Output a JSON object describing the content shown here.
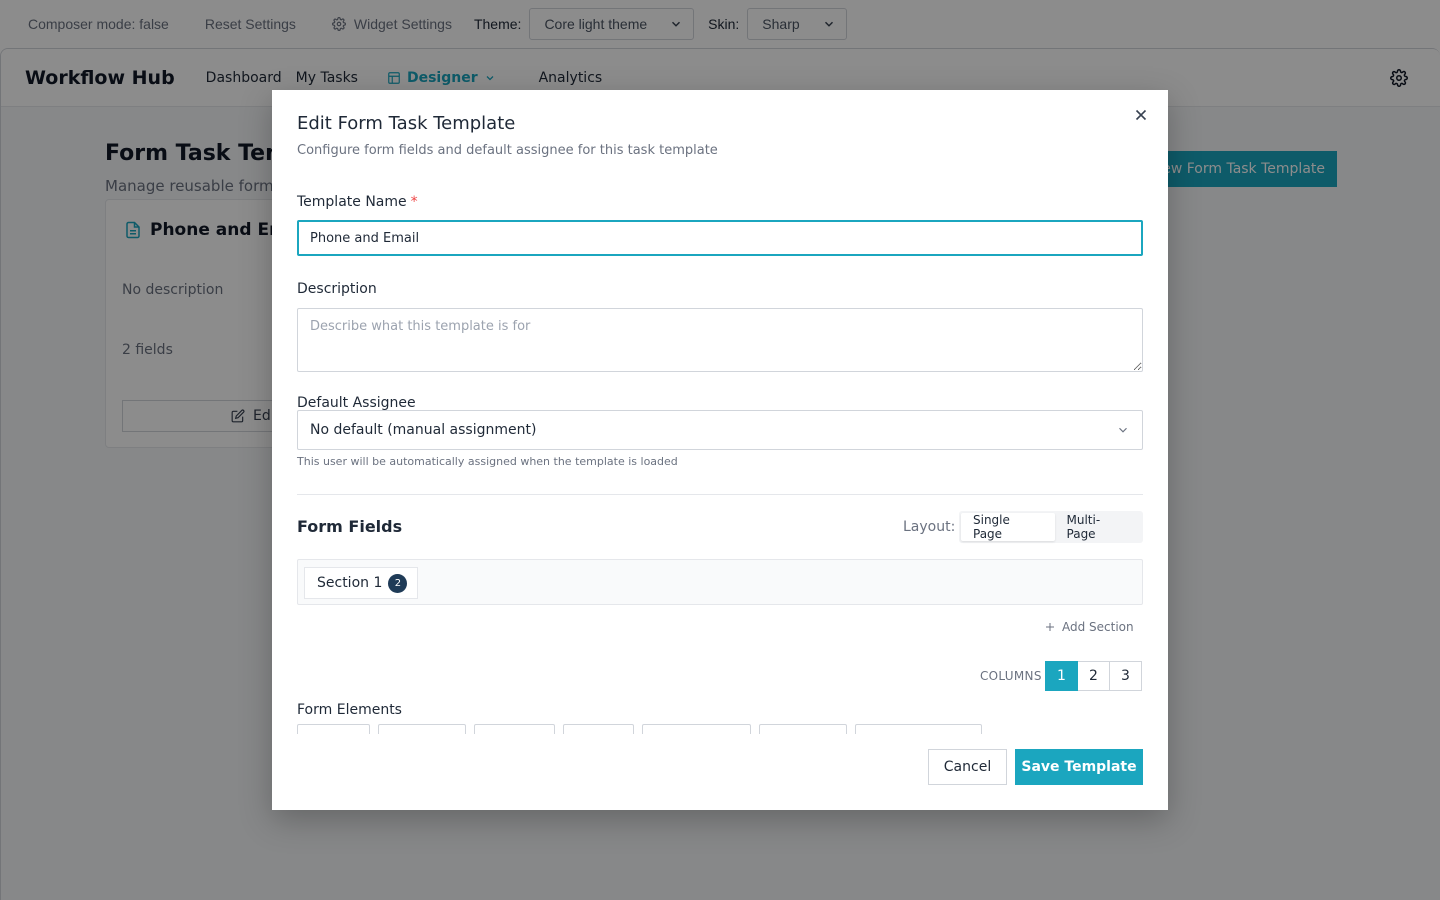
{
  "devbar": {
    "composer_mode": "Composer mode: false",
    "reset_settings": "Reset Settings",
    "widget_settings": "Widget Settings",
    "theme_label": "Theme:",
    "theme_value": "Core light theme",
    "skin_label": "Skin:",
    "skin_value": "Sharp"
  },
  "header": {
    "brand": "Workflow Hub",
    "nav": {
      "dashboard": "Dashboard",
      "my_tasks": "My Tasks",
      "designer": "Designer",
      "analytics": "Analytics"
    }
  },
  "page": {
    "title": "Form Task Tem",
    "subtitle": "Manage reusable form",
    "new_button": "New Form Task Template"
  },
  "template_card": {
    "title": "Phone and Em",
    "description": "No description",
    "fields": "2 fields",
    "edit": "Ed"
  },
  "modal": {
    "title": "Edit Form Task Template",
    "subtitle": "Configure form fields and default assignee for this task template",
    "name_label": "Template Name",
    "required_mark": "*",
    "name_value": "Phone and Email",
    "description_label": "Description",
    "description_placeholder": "Describe what this template is for",
    "assignee_label": "Default Assignee",
    "assignee_value": "No default (manual assignment)",
    "assignee_hint": "This user will be automatically assigned when the template is loaded",
    "form_fields_title": "Form Fields",
    "layout_label": "Layout:",
    "layout_options": [
      "Single Page",
      "Multi-Page"
    ],
    "layout_selected": "Single Page",
    "section_label": "Section 1",
    "section_count": "2",
    "add_section": "Add Section",
    "columns_label": "COLUMNS",
    "columns_options": [
      "1",
      "2",
      "3"
    ],
    "columns_selected": "1",
    "form_elements_title": "Form Elements",
    "cancel": "Cancel",
    "save": "Save Template"
  },
  "colors": {
    "accent": "#1ba6bf",
    "badge": "#1f3b57",
    "required": "#ef4444"
  }
}
